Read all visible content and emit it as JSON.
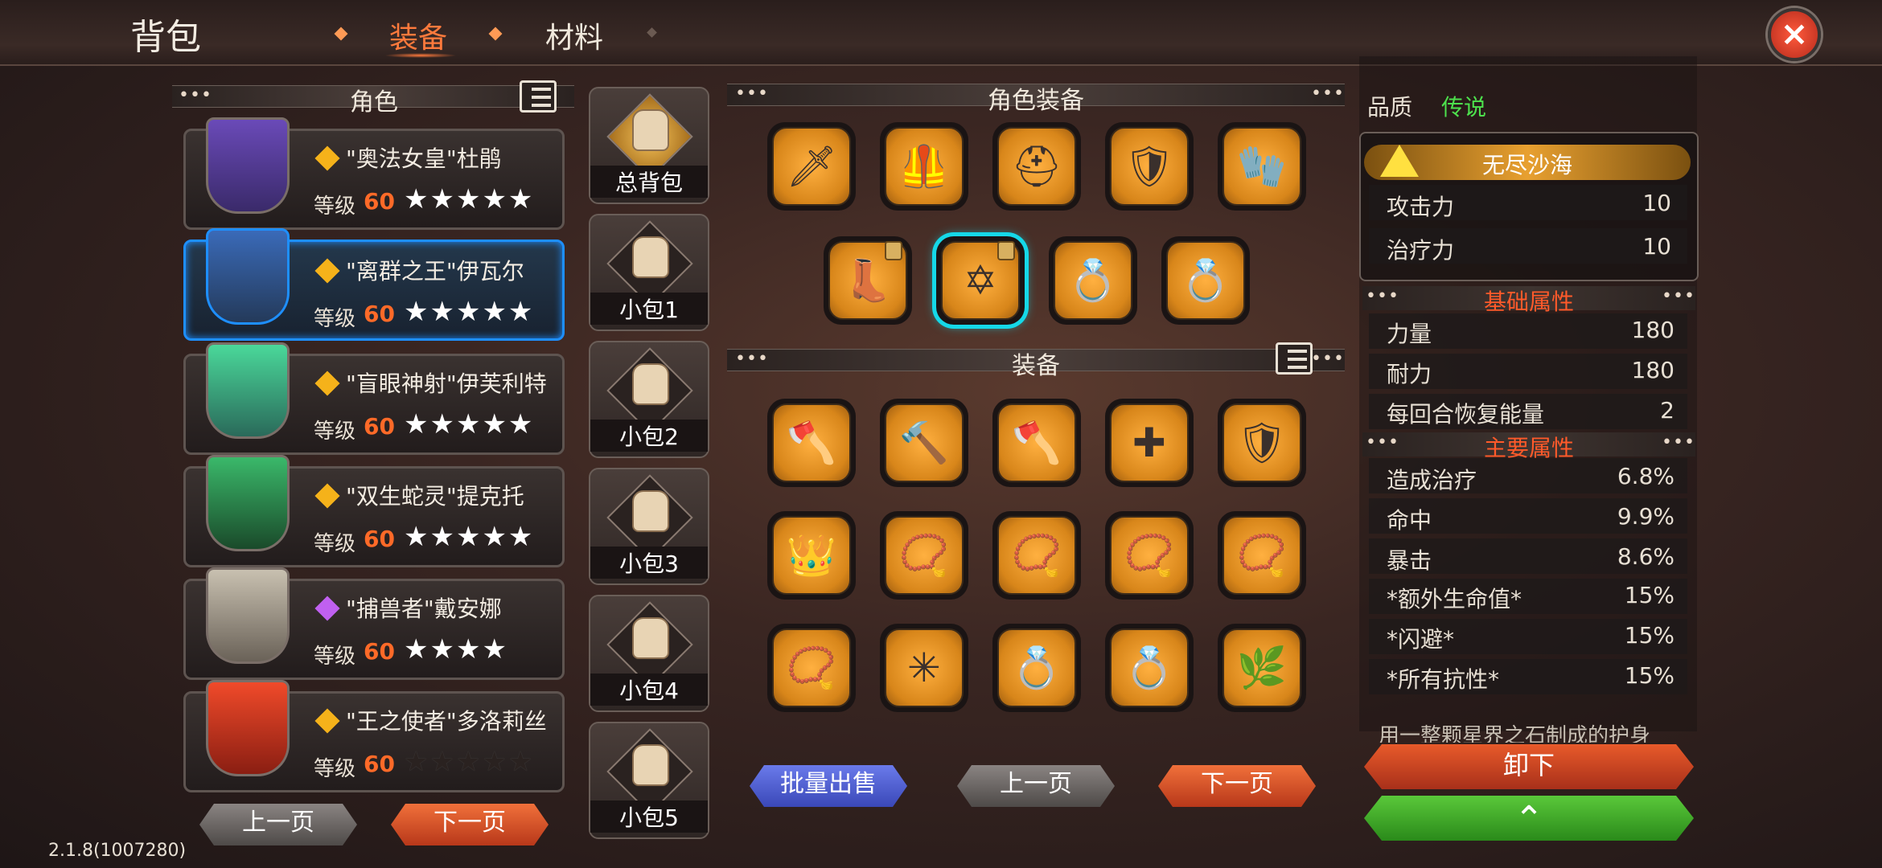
{
  "header": {
    "title": "背包",
    "tabs": [
      {
        "label": "装备",
        "active": true
      },
      {
        "label": "材料",
        "active": false
      }
    ]
  },
  "characters_panel": {
    "title": "角色",
    "level_label": "等级",
    "characters": [
      {
        "name": "\"奥法女皇\"杜鹃",
        "level": "60",
        "stars": "★★★★★",
        "gem_color": "#f5b21a"
      },
      {
        "name": "\"离群之王\"伊瓦尔",
        "level": "60",
        "stars": "★★★★★",
        "gem_color": "#f5b21a"
      },
      {
        "name": "\"盲眼神射\"伊芙利特",
        "level": "60",
        "stars": "★★★★★",
        "gem_color": "#f5b21a"
      },
      {
        "name": "\"双生蛇灵\"提克托",
        "level": "60",
        "stars": "★★★★★",
        "gem_color": "#f5b21a"
      },
      {
        "name": "\"捕兽者\"戴安娜",
        "level": "60",
        "stars": "★★★★",
        "gem_color": "#c060f0"
      },
      {
        "name": "\"王之使者\"多洛莉丝",
        "level": "60",
        "stars": "★★★★★",
        "gem_color": "#f5b21a"
      }
    ],
    "prev_label": "上一页",
    "next_label": "下一页"
  },
  "bags": [
    "总背包",
    "小包1",
    "小包2",
    "小包3",
    "小包4",
    "小包5"
  ],
  "character_equipment": {
    "title": "角色装备",
    "row1_icons": [
      "🗡",
      "🦺",
      "⛑",
      "🛡",
      "🧤"
    ],
    "row2_icons": [
      "👢",
      "✡",
      "💍",
      "💍"
    ]
  },
  "equipment": {
    "title": "装备",
    "icons": [
      "🪓",
      "🔨",
      "🪓",
      "✚",
      "🛡",
      "👑",
      "📿",
      "📿",
      "📿",
      "📿",
      "📿",
      "✳",
      "💍",
      "💍",
      "🌿"
    ]
  },
  "bottom_buttons": {
    "bulk_sell": "批量出售",
    "prev": "上一页",
    "next": "下一页"
  },
  "item_detail": {
    "quality_label": "品质",
    "quality_value": "传说",
    "set_name": "无尽沙海",
    "set_stats": [
      {
        "name": "攻击力",
        "value": "10"
      },
      {
        "name": "治疗力",
        "value": "10"
      }
    ],
    "base_title": "基础属性",
    "base_stats": [
      {
        "name": "力量",
        "value": "180"
      },
      {
        "name": "耐力",
        "value": "180"
      },
      {
        "name": "每回合恢复能量",
        "value": "2"
      }
    ],
    "main_title": "主要属性",
    "main_stats": [
      {
        "name": "造成治疗",
        "value": "6.8%"
      },
      {
        "name": "命中",
        "value": "9.9%"
      },
      {
        "name": "暴击",
        "value": "8.6%"
      },
      {
        "name": "*额外生命值*",
        "value": "15%"
      },
      {
        "name": "*闪避*",
        "value": "15%"
      },
      {
        "name": "*所有抗性*",
        "value": "15%"
      }
    ],
    "description": "用一整颗星界之石制成的护身",
    "unequip_label": "卸下",
    "up_icon": "⌃"
  },
  "version": "2.1.8(1007280)",
  "colors": {
    "accent": "#ff7a3c",
    "quality": "#4de04d",
    "select": "#15d8e8"
  }
}
